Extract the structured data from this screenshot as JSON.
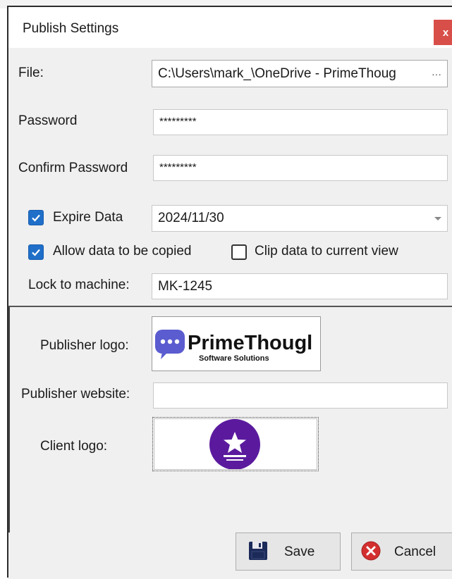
{
  "window": {
    "title": "Publish Settings",
    "close_label": "x"
  },
  "file": {
    "label": "File:",
    "value": "C:\\Users\\mark_\\OneDrive - PrimeThoug",
    "browse_label": "···"
  },
  "password": {
    "label": "Password",
    "value": "*********"
  },
  "confirm_password": {
    "label": "Confirm Password",
    "value": "*********"
  },
  "expire": {
    "label": "Expire Data",
    "checked": true,
    "value": "2024/11/30"
  },
  "allow_copy": {
    "label": "Allow data to be copied",
    "checked": true
  },
  "clip_view": {
    "label": "Clip data to current view",
    "checked": false
  },
  "lock_machine": {
    "label": "Lock to machine:",
    "value": "MK-1245"
  },
  "publisher_logo": {
    "label": "Publisher logo:",
    "brand_name": "PrimeThougl",
    "tagline": "Software Solutions"
  },
  "publisher_website": {
    "label": "Publisher website:",
    "value": ""
  },
  "client_logo": {
    "label": "Client logo:"
  },
  "buttons": {
    "save": "Save",
    "cancel": "Cancel"
  },
  "colors": {
    "accent_blue": "#1f6fc8",
    "close_red": "#d84f49",
    "logo_purple": "#5a5ccf",
    "client_purple": "#5b1a9e",
    "cancel_red": "#d32f2f",
    "save_navy": "#1c2a5a"
  },
  "icons": {
    "checked": "check-icon",
    "save": "floppy-disk-icon",
    "cancel": "cancel-x-icon",
    "client": "star-medal-icon",
    "dropdown": "chevron-down-icon"
  }
}
